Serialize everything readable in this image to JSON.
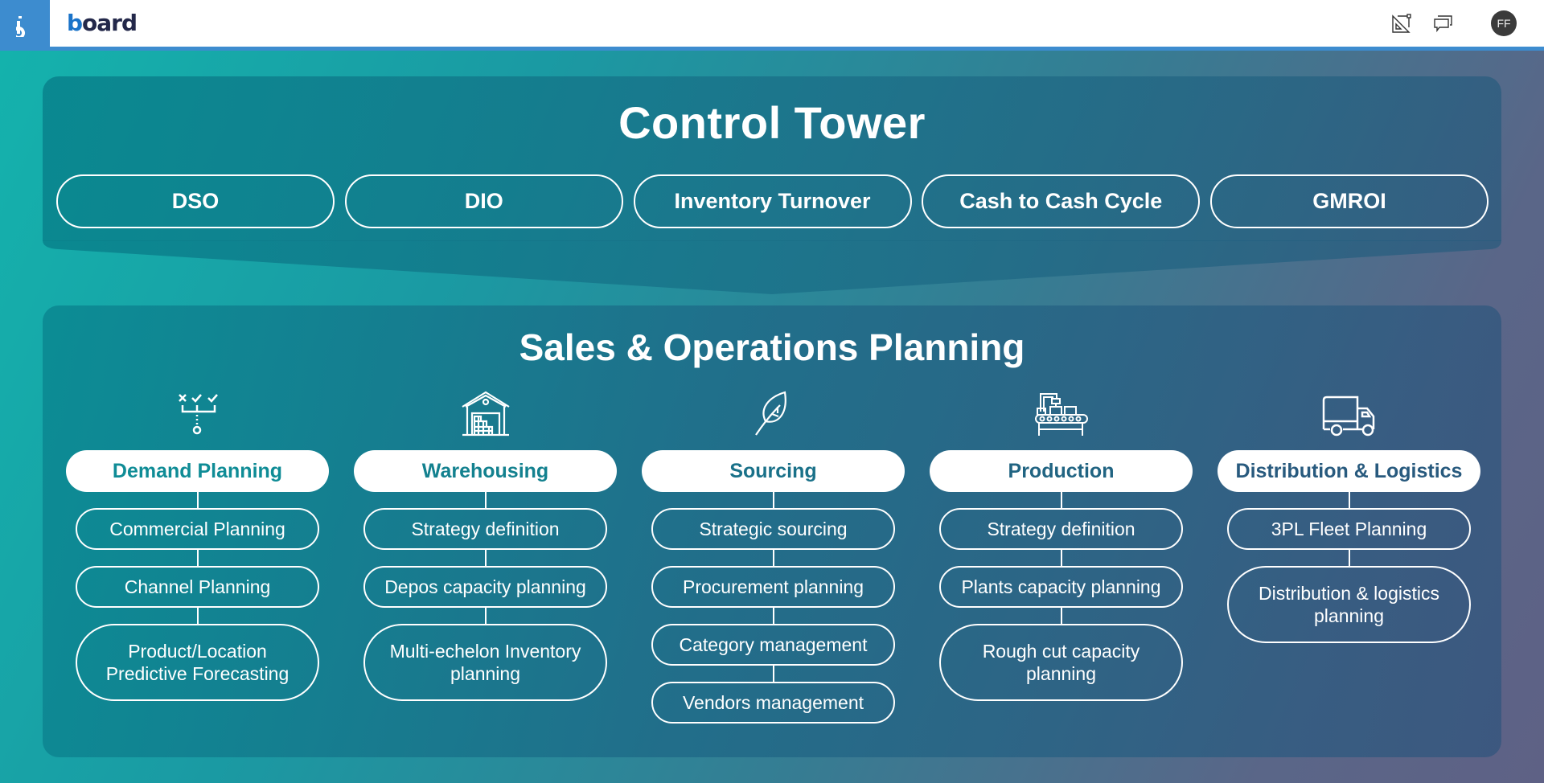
{
  "header": {
    "logo_letter": "b",
    "logo_text_first": "b",
    "logo_text_rest": "oard",
    "icons": [
      "design-mode-icon",
      "chat-icon"
    ],
    "user_initials": "FF"
  },
  "control_tower": {
    "title": "Control Tower",
    "kpis": [
      "DSO",
      "DIO",
      "Inventory Turnover",
      "Cash to Cash Cycle",
      "GMROI"
    ]
  },
  "sop": {
    "title": "Sales & Operations Planning",
    "columns": [
      {
        "icon": "decision-tree-icon",
        "label": "Demand Planning",
        "color": "#0f8c96",
        "items": [
          "Commercial Planning",
          "Channel Planning",
          "Product/Location Predictive Forecasting"
        ]
      },
      {
        "icon": "warehouse-icon",
        "label": "Warehousing",
        "color": "#13818f",
        "items": [
          "Strategy definition",
          "Depos capacity planning",
          "Multi-echelon Inventory planning"
        ]
      },
      {
        "icon": "leaf-icon",
        "label": "Sourcing",
        "color": "#1a7189",
        "items": [
          "Strategic sourcing",
          "Procurement planning",
          "Category management",
          "Vendors management"
        ]
      },
      {
        "icon": "production-line-icon",
        "label": "Production",
        "color": "#216482",
        "items": [
          "Strategy definition",
          "Plants capacity planning",
          "Rough cut capacity planning"
        ]
      },
      {
        "icon": "truck-icon",
        "label": "Distribution & Logistics",
        "color": "#285a7e",
        "items": [
          "3PL Fleet Planning",
          "Distribution & logistics planning"
        ]
      }
    ]
  }
}
